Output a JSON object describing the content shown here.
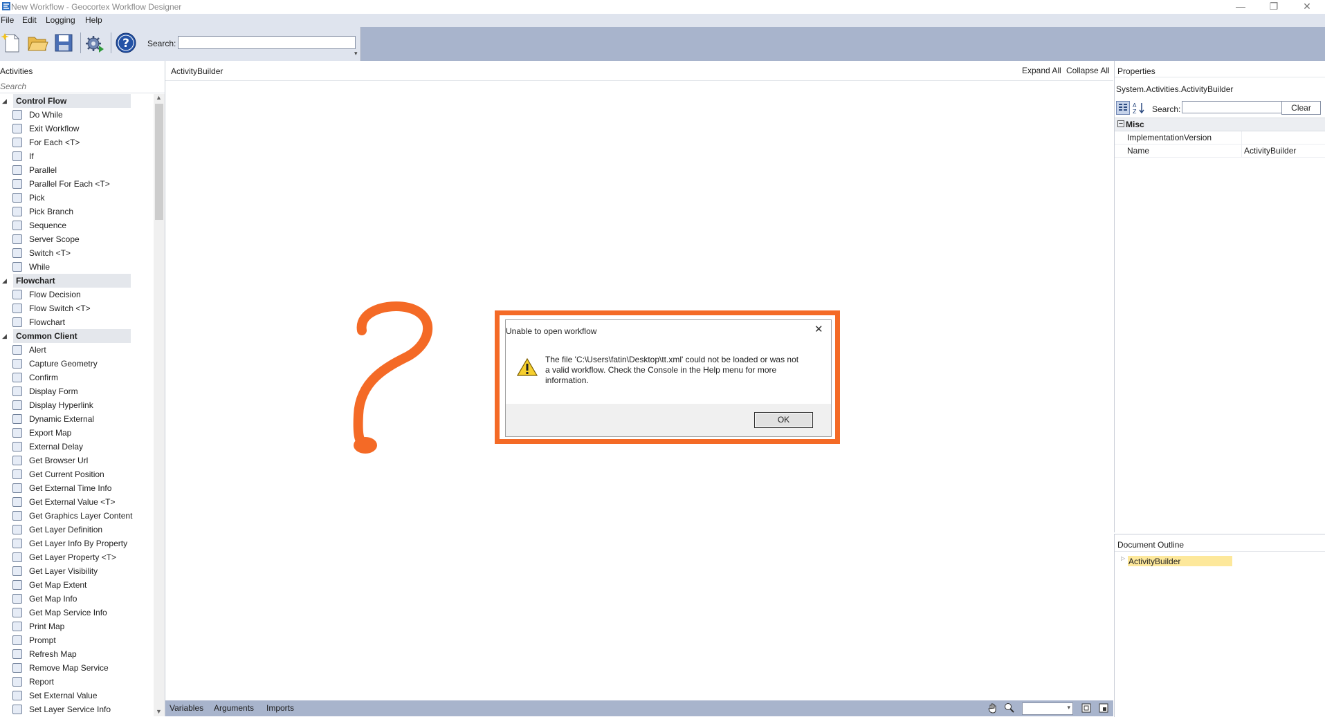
{
  "window": {
    "title": "New Workflow - Geocortex Workflow Designer",
    "controls": [
      "—",
      "❐",
      "✕"
    ]
  },
  "menu": [
    "File",
    "Edit",
    "Logging",
    "Help"
  ],
  "toolbar": {
    "icons": [
      "new-file-icon",
      "open-folder-icon",
      "save-icon",
      "settings-gear-icon",
      "help-icon"
    ],
    "search_label": "Search:",
    "search_value": ""
  },
  "activities": {
    "title": "Activities",
    "search_placeholder": "Search",
    "categories": [
      {
        "name": "Control Flow",
        "items": [
          "Do While",
          "Exit Workflow",
          "For Each <T>",
          "If",
          "Parallel",
          "Parallel For Each <T>",
          "Pick",
          "Pick Branch",
          "Sequence",
          "Server Scope",
          "Switch <T>",
          "While"
        ]
      },
      {
        "name": "Flowchart",
        "items": [
          "Flow Decision",
          "Flow Switch <T>",
          "Flowchart"
        ]
      },
      {
        "name": "Common Client",
        "items": [
          "Alert",
          "Capture Geometry",
          "Confirm",
          "Display Form",
          "Display Hyperlink",
          "Dynamic External",
          "Export Map",
          "External Delay",
          "Get Browser Url",
          "Get Current Position",
          "Get External Time Info",
          "Get External Value <T>",
          "Get Graphics Layer Content",
          "Get Layer Definition",
          "Get Layer Info By Property",
          "Get Layer Property <T>",
          "Get Layer Visibility",
          "Get Map Extent",
          "Get Map Info",
          "Get Map Service Info",
          "Print Map",
          "Prompt",
          "Refresh Map",
          "Remove Map Service",
          "Report",
          "Set External Value",
          "Set Layer Service Info"
        ]
      }
    ]
  },
  "designer": {
    "breadcrumb": "ActivityBuilder",
    "expand_all": "Expand All",
    "collapse_all": "Collapse All",
    "footer_tabs": [
      "Variables",
      "Arguments",
      "Imports"
    ]
  },
  "properties": {
    "title": "Properties",
    "object": "System.Activities.ActivityBuilder",
    "search_label": "Search:",
    "clear_label": "Clear",
    "category": "Misc",
    "rows": [
      {
        "name": "ImplementationVersion",
        "value": ""
      },
      {
        "name": "Name",
        "value": "ActivityBuilder"
      }
    ]
  },
  "document_outline": {
    "title": "Document Outline",
    "item": "ActivityBuilder"
  },
  "dialog": {
    "title": "Unable to open workflow",
    "message_lines": [
      "The file 'C:\\Users\\fatin\\Desktop\\tt.xml' could not be loaded or was not",
      "a valid workflow. Check the Console in the Help menu for more",
      "information."
    ],
    "ok_label": "OK"
  },
  "colors": {
    "highlight_frame": "#f46a26",
    "toolbar_bg": "#a8b4cc",
    "outline_selection": "#fde89b"
  }
}
